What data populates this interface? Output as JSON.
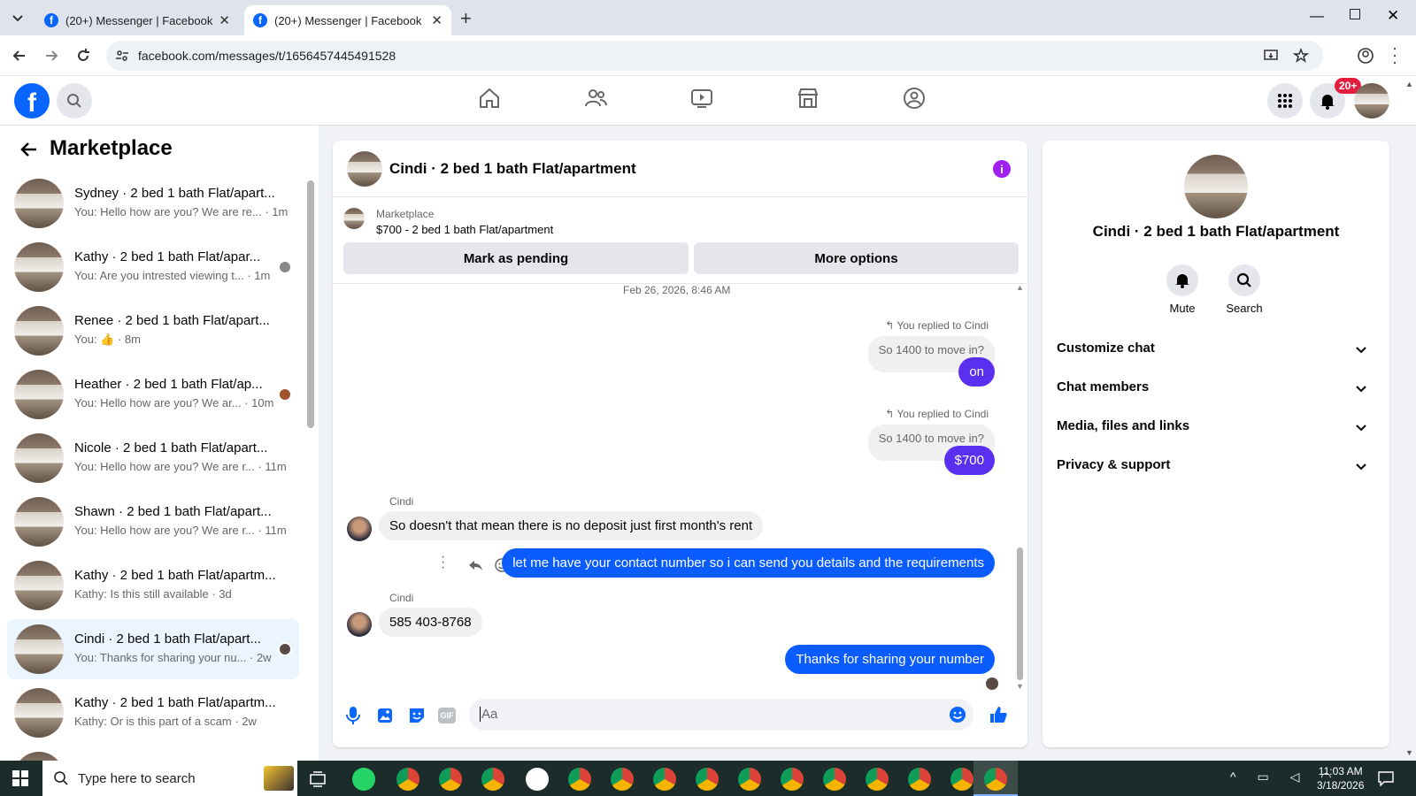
{
  "browser": {
    "tabs": [
      {
        "title": "(20+) Messenger | Facebook",
        "active": false
      },
      {
        "title": "(20+) Messenger | Facebook",
        "active": true
      }
    ],
    "url": "facebook.com/messages/t/1656457445491528"
  },
  "fb_header": {
    "notification_badge": "20+"
  },
  "sidebar": {
    "title": "Marketplace",
    "conversations": [
      {
        "name": "Sydney · 2 bed 1 bath Flat/apart...",
        "preview": "You: Hello how are you? We are re... · 1m"
      },
      {
        "name": "Kathy · 2 bed 1 bath Flat/apar...",
        "preview": "You: Are you intrested viewing t... · 1m"
      },
      {
        "name": "Renee · 2 bed 1 bath Flat/apart...",
        "preview": "You: 👍 · 8m"
      },
      {
        "name": "Heather · 2 bed 1 bath Flat/ap...",
        "preview": "You: Hello how are you? We ar... · 10m"
      },
      {
        "name": "Nicole · 2 bed 1 bath Flat/apart...",
        "preview": "You: Hello how are you? We are r... · 11m"
      },
      {
        "name": "Shawn · 2 bed 1 bath Flat/apart...",
        "preview": "You: Hello how are you? We are r... · 11m"
      },
      {
        "name": "Kathy · 2 bed 1 bath Flat/apartm...",
        "preview": "Kathy: Is this still available · 3d"
      },
      {
        "name": "Cindi · 2 bed 1 bath Flat/apart...",
        "preview": "You: Thanks for sharing your nu... · 2w",
        "active": true
      },
      {
        "name": "Kathy · 2 bed 1 bath Flat/apartm...",
        "preview": "Kathy: Or is this part of a scam · 2w"
      }
    ]
  },
  "chat": {
    "title": "Cindi · 2 bed 1 bath Flat/apartment",
    "listing_source": "Marketplace",
    "listing_title": "$700 - 2 bed 1 bath Flat/apartment",
    "mark_pending": "Mark as pending",
    "more_options": "More options",
    "timestamp": "Feb 26, 2026, 8:46 AM",
    "messages": {
      "reply_note_1": "You replied to Cindi",
      "quoted_1": "So 1400 to move in?",
      "msg_on": "on",
      "reply_note_2": "You replied to Cindi",
      "quoted_2": "So 1400 to move in?",
      "msg_700": "$700",
      "sender_1": "Cindi",
      "msg_deposit": "So doesn't that mean there is no deposit just first month's rent",
      "msg_contact": "let me have your contact number so i can send you details and the requirements",
      "sender_2": "Cindi",
      "msg_number": "585 403-8768",
      "msg_thanks": "Thanks for sharing your number"
    },
    "composer_placeholder": "Aa"
  },
  "info_panel": {
    "name": "Cindi · 2 bed 1 bath Flat/apartment",
    "mute": "Mute",
    "search": "Search",
    "sections": [
      "Customize chat",
      "Chat members",
      "Media, files and links",
      "Privacy & support"
    ]
  },
  "taskbar": {
    "search_placeholder": "Type here to search",
    "time": "11:03 AM",
    "date": "3/18/2026"
  },
  "colors": {
    "fb_blue": "#0866ff",
    "outgoing_bubble": "#0a5cff",
    "purple_bubble": "#5b2ff0",
    "active_conv": "#ebf5ff"
  }
}
